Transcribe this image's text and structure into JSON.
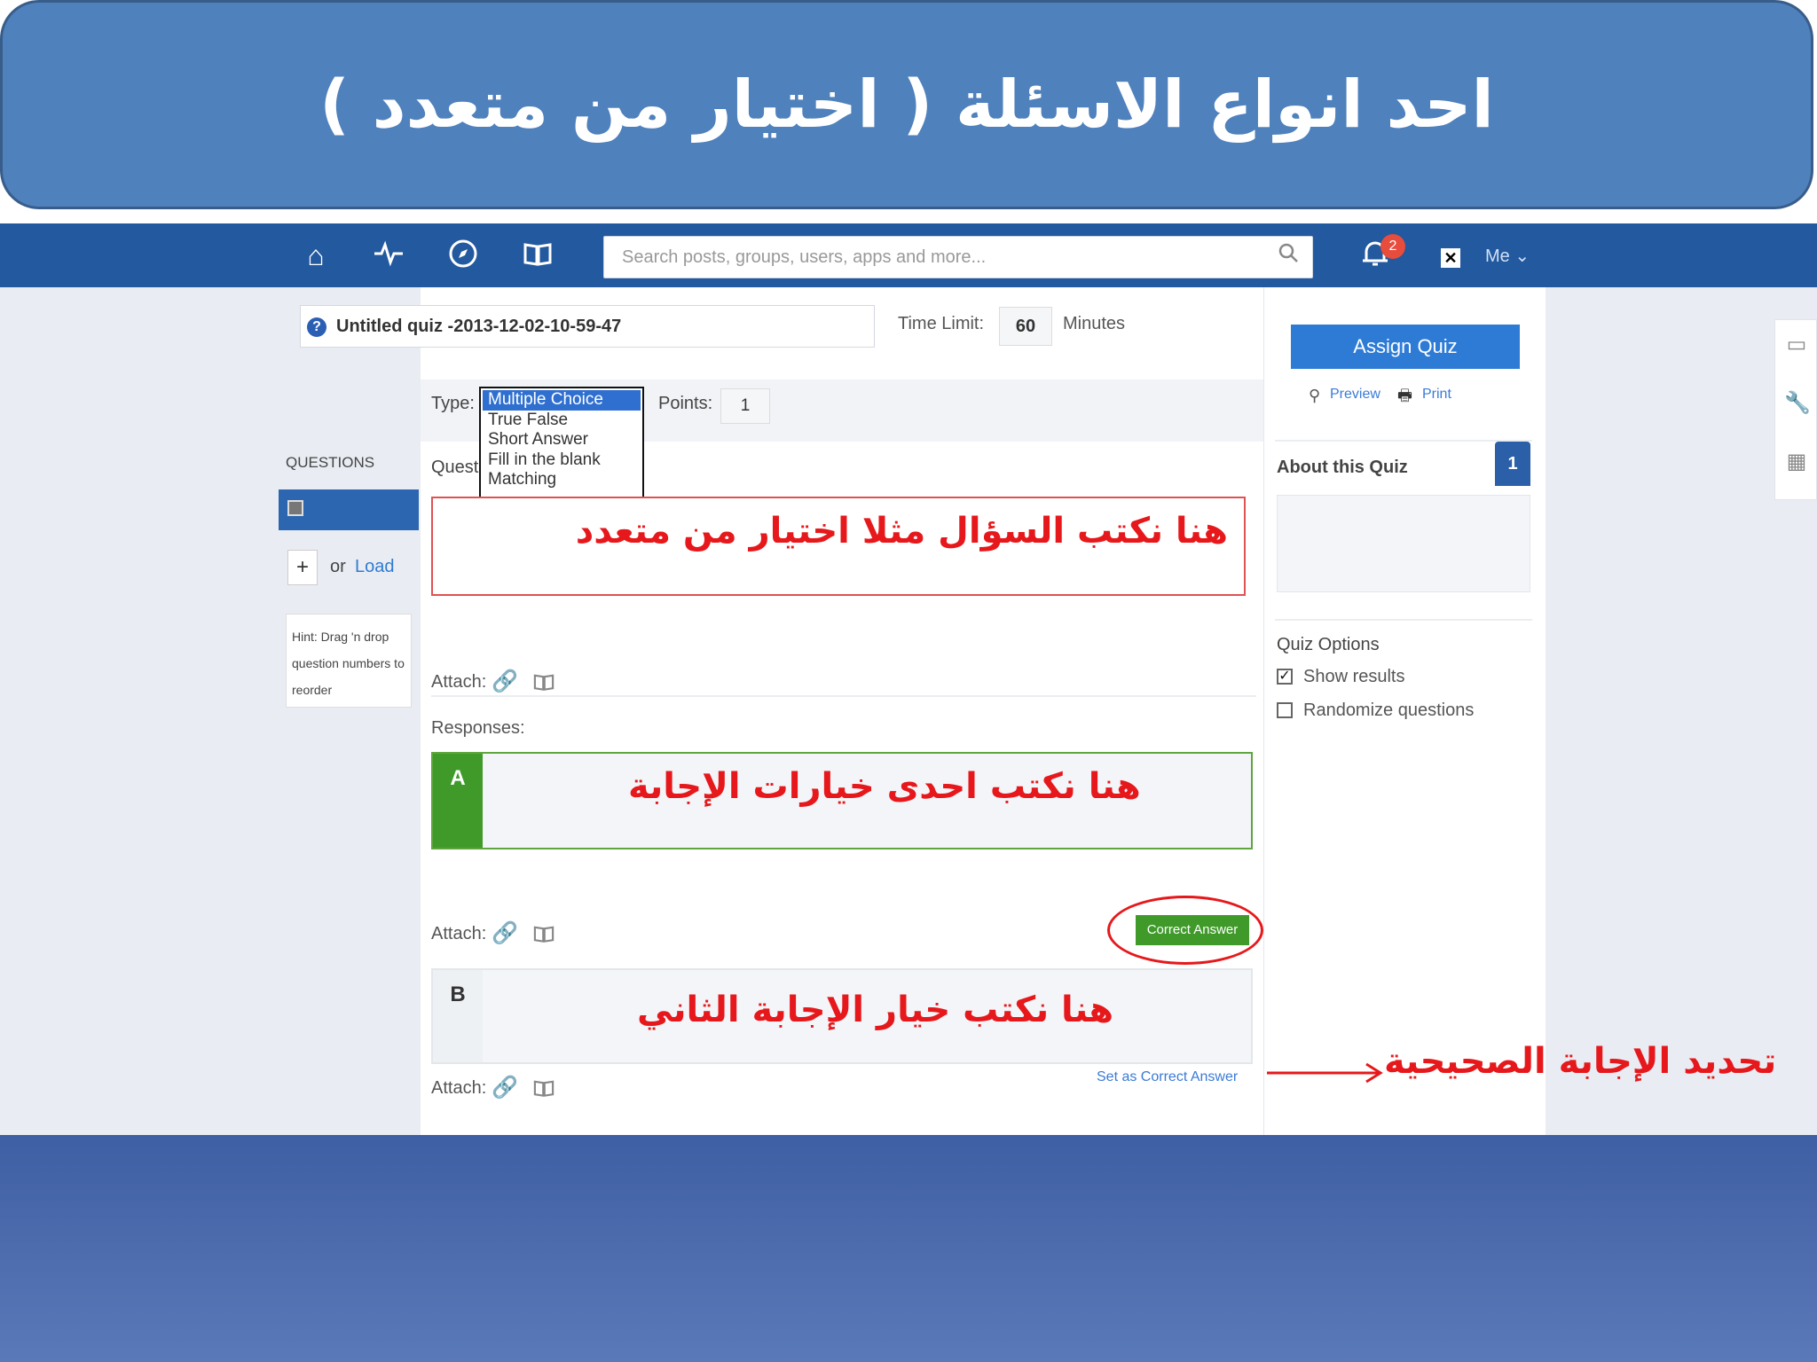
{
  "slide": {
    "title": "احد انواع الاسئلة ( اختيار من متعدد )"
  },
  "topbar": {
    "search_placeholder": "Search posts, groups, users, apps and more...",
    "notifications_count": "2",
    "me_label": "Me ⌄"
  },
  "quiz": {
    "title": "Untitled quiz -2013-12-02-10-59-47",
    "time_limit_label": "Time Limit:",
    "time_limit_value": "60",
    "minutes_label": "Minutes"
  },
  "questions_panel": {
    "label": "QUESTIONS",
    "add_symbol": "+",
    "or_text": "or",
    "load_link": "Load",
    "hint": "Hint: Drag 'n drop question numbers to reorder"
  },
  "editor": {
    "type_label": "Type:",
    "type_options": [
      "Multiple Choice",
      "True False",
      "Short Answer",
      "Fill in the blank",
      "Matching"
    ],
    "selected_type": "Multiple Choice",
    "points_label": "Points:",
    "points_value": "1",
    "question_label": "Question:",
    "attach_label": "Attach:",
    "responses_label": "Responses:",
    "response_a_letter": "A",
    "response_b_letter": "B",
    "correct_answer_button": "Correct Answer",
    "set_correct_link": "Set as Correct Answer"
  },
  "annotations": {
    "question": "هنا نكتب السؤال مثلا اختيار من متعدد",
    "response_a": "هنا نكتب احدى خيارات الإجابة",
    "response_b": "هنا نكتب خيار الإجابة الثاني",
    "correct": "تحديد الإجابة الصحيحية"
  },
  "sidebar": {
    "assign_button": "Assign Quiz",
    "preview_link": "Preview",
    "print_link": "Print",
    "about_label": "About this Quiz",
    "about_badge": "1",
    "options_label": "Quiz Options",
    "show_results": "Show results",
    "show_results_checked": true,
    "randomize": "Randomize questions",
    "randomize_checked": false
  },
  "colors": {
    "banner": "#4f81bd",
    "topbar": "#23599e",
    "annotation_red": "#e6181b",
    "correct_green": "#3f9a2a",
    "accent_blue": "#2e7bd6"
  }
}
